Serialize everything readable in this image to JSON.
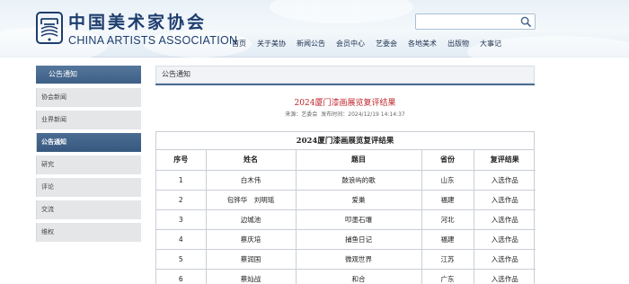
{
  "header": {
    "logo_cn": "中国美术家协会",
    "logo_en": "CHINA ARTISTS ASSOCIATION",
    "search_placeholder": "",
    "nav": [
      "首页",
      "关于美协",
      "新闻公告",
      "会员中心",
      "艺委会",
      "各地美术",
      "出版物",
      "大事记"
    ]
  },
  "sidebar": {
    "title": "公告通知",
    "items": [
      {
        "label": "协会新闻",
        "active": false
      },
      {
        "label": "业界新闻",
        "active": false
      },
      {
        "label": "公告通知",
        "active": true
      },
      {
        "label": "研究",
        "active": false
      },
      {
        "label": "评论",
        "active": false
      },
      {
        "label": "交流",
        "active": false
      },
      {
        "label": "维权",
        "active": false
      }
    ]
  },
  "main": {
    "tab_label": "公告通知",
    "article_title": "2024厦门漆画展览复评结果",
    "meta_source": "来源：艺委会",
    "meta_time": "发布时间：2024/12/19 14:14:37",
    "table": {
      "caption": "2024厦门漆画展览复评结果",
      "headers": [
        "序号",
        "姓名",
        "题目",
        "省份",
        "复评结果"
      ],
      "rows": [
        [
          "1",
          "白木伟",
          "鼓浪屿的歌",
          "山东",
          "入选作品"
        ],
        [
          "2",
          "包铧华　刘明瑶",
          "爱巢",
          "福建",
          "入选作品"
        ],
        [
          "3",
          "边城池",
          "叩墨石壤",
          "河北",
          "入选作品"
        ],
        [
          "4",
          "蔡庆培",
          "捕鱼日记",
          "福建",
          "入选作品"
        ],
        [
          "5",
          "蔡润国",
          "微观世界",
          "江苏",
          "入选作品"
        ],
        [
          "6",
          "蔡灿战",
          "和合",
          "广东",
          "入选作品"
        ]
      ]
    }
  },
  "colors": {
    "accent": "#3d5e85",
    "title_red": "#c0272d",
    "logo_blue": "#1d3d6e"
  }
}
